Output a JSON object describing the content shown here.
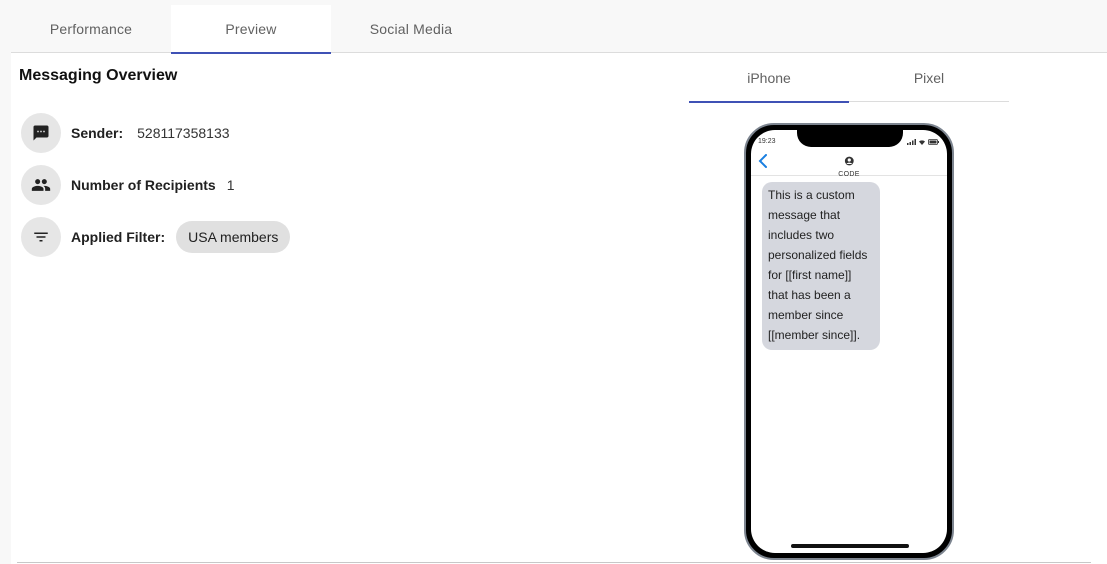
{
  "tabs": [
    {
      "label": "Performance",
      "active": false
    },
    {
      "label": "Preview",
      "active": true
    },
    {
      "label": "Social Media",
      "active": false
    }
  ],
  "overview": {
    "title": "Messaging Overview",
    "sender": {
      "icon": "message-icon",
      "label": "Sender:",
      "value": "528117358133"
    },
    "recipients": {
      "icon": "people-icon",
      "label": "Number of Recipients",
      "value": "1"
    },
    "filter": {
      "icon": "filter-icon",
      "label": "Applied Filter:",
      "chip": "USA members"
    }
  },
  "device_tabs": [
    {
      "label": "iPhone",
      "active": true
    },
    {
      "label": "Pixel",
      "active": false
    }
  ],
  "phone": {
    "status_time": "19:23",
    "contact_name": "CODE",
    "message_lines": [
      "This is a custom",
      "message that",
      "includes two",
      "personalized fields",
      "for [[first name]]",
      "that has been a",
      "member since",
      "[[member since]]."
    ]
  },
  "colors": {
    "accent": "#3f51b5",
    "chip_bg": "#e0e0e0",
    "bubble_bg": "#d5d7de",
    "back_chevron": "#1a7fe0"
  }
}
